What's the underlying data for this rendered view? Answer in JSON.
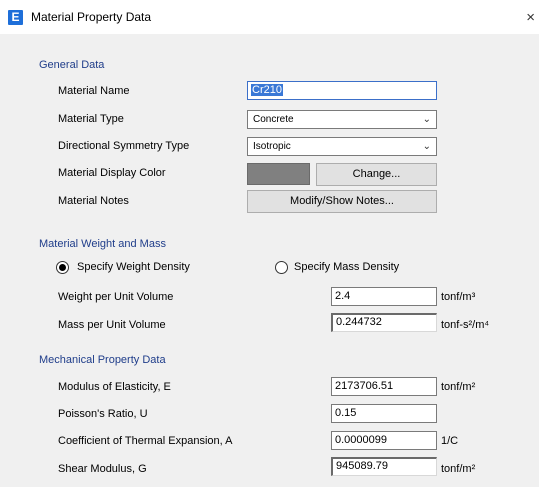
{
  "window": {
    "title": "Material Property Data",
    "app_icon_letter": "E",
    "close_symbol": "×"
  },
  "general": {
    "header": "General Data",
    "material_name": {
      "label": "Material Name",
      "value": "Cr210"
    },
    "material_type": {
      "label": "Material Type",
      "value": "Concrete"
    },
    "symmetry_type": {
      "label": "Directional Symmetry Type",
      "value": "Isotropic"
    },
    "display_color": {
      "label": "Material Display Color",
      "color": "#808080",
      "button": "Change..."
    },
    "notes": {
      "label": "Material Notes",
      "button": "Modify/Show Notes..."
    }
  },
  "weight_mass": {
    "header": "Material Weight and Mass",
    "option_weight": "Specify Weight Density",
    "option_mass": "Specify Mass Density",
    "selected": "weight",
    "weight_per_volume": {
      "label": "Weight per Unit Volume",
      "value": "2.4",
      "unit": "tonf/m³"
    },
    "mass_per_volume": {
      "label": "Mass per Unit Volume",
      "value": "0.244732",
      "unit": "tonf-s²/m⁴"
    }
  },
  "mechanical": {
    "header": "Mechanical Property Data",
    "modulus": {
      "label": "Modulus of Elasticity,  E",
      "value": "2173706.51",
      "unit": "tonf/m²"
    },
    "poisson": {
      "label": "Poisson's Ratio,  U",
      "value": "0.15",
      "unit": ""
    },
    "thermal": {
      "label": "Coefficient of Thermal Expansion,  A",
      "value": "0.0000099",
      "unit": "1/C"
    },
    "shear": {
      "label": "Shear Modulus,  G",
      "value": "945089.79",
      "unit": "tonf/m²"
    }
  },
  "colors": {
    "section_header": "#1f3d8a",
    "selection_highlight": "#3a78d6",
    "dialog_background": "#f0f0f0"
  },
  "icons": {
    "app": "etabs-app-icon",
    "close": "close-icon",
    "dropdown": "chevron-down-icon"
  }
}
